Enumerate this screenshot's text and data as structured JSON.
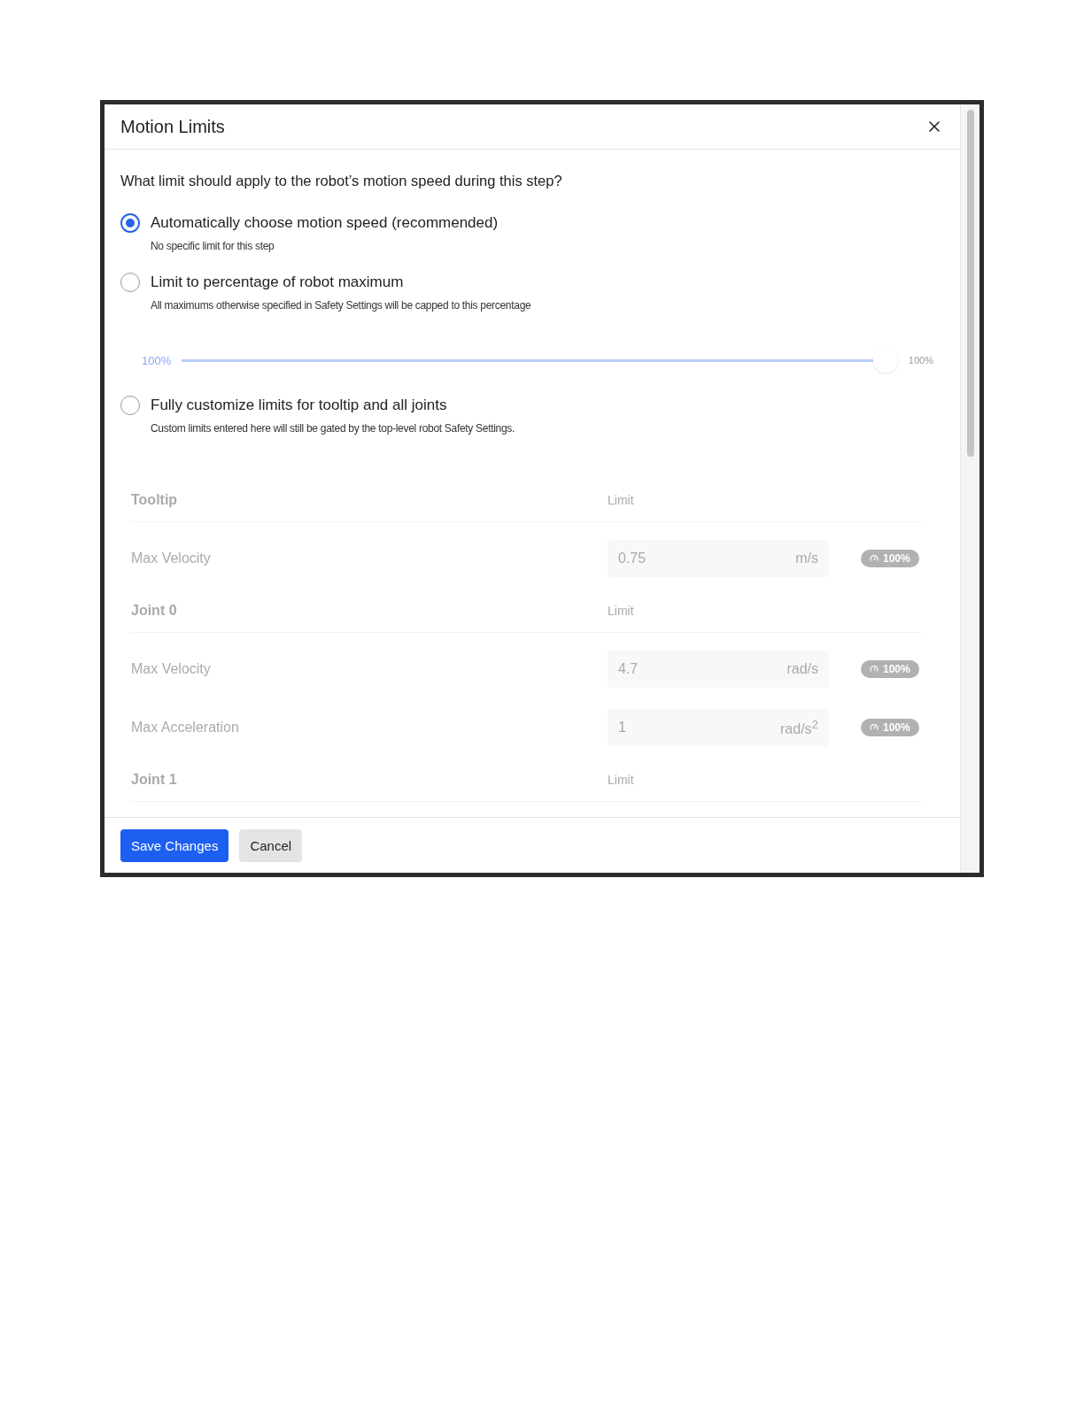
{
  "dialog": {
    "title": "Motion Limits",
    "question": "What limit should apply to the robot’s motion speed during this step?",
    "options": [
      {
        "label": "Automatically choose motion speed (recommended)",
        "description": "No specific limit for this step",
        "selected": true
      },
      {
        "label": "Limit to percentage of robot maximum",
        "description": "All maximums otherwise specified in Safety Settings will be capped to this percentage",
        "selected": false
      },
      {
        "label": "Fully customize limits for tooltip and all joints",
        "description": "Custom limits entered here will still be gated by the top-level robot Safety Settings.",
        "selected": false
      }
    ],
    "slider": {
      "value_label": "100%",
      "max_label": "100%",
      "level": 1,
      "disabled": true
    },
    "custom_limits": {
      "disabled": true,
      "groups": [
        {
          "title": "Tooltip",
          "column_label": "Limit",
          "rows": [
            {
              "label": "Max Velocity",
              "value": "0.75",
              "unit": "m/s",
              "badge": "100%"
            }
          ]
        },
        {
          "title": "Joint 0",
          "column_label": "Limit",
          "rows": [
            {
              "label": "Max Velocity",
              "value": "4.7",
              "unit": "rad/s",
              "badge": "100%"
            },
            {
              "label": "Max Acceleration",
              "value": "1",
              "unit": "rad/s$^{2}$",
              "badge": "100%"
            }
          ]
        },
        {
          "title": "Joint 1",
          "column_label": "Limit"
        }
      ]
    },
    "buttons": [
      {
        "label": "Save Changes",
        "kind": "primary"
      },
      {
        "label": "Cancel",
        "kind": "secondary"
      }
    ]
  }
}
